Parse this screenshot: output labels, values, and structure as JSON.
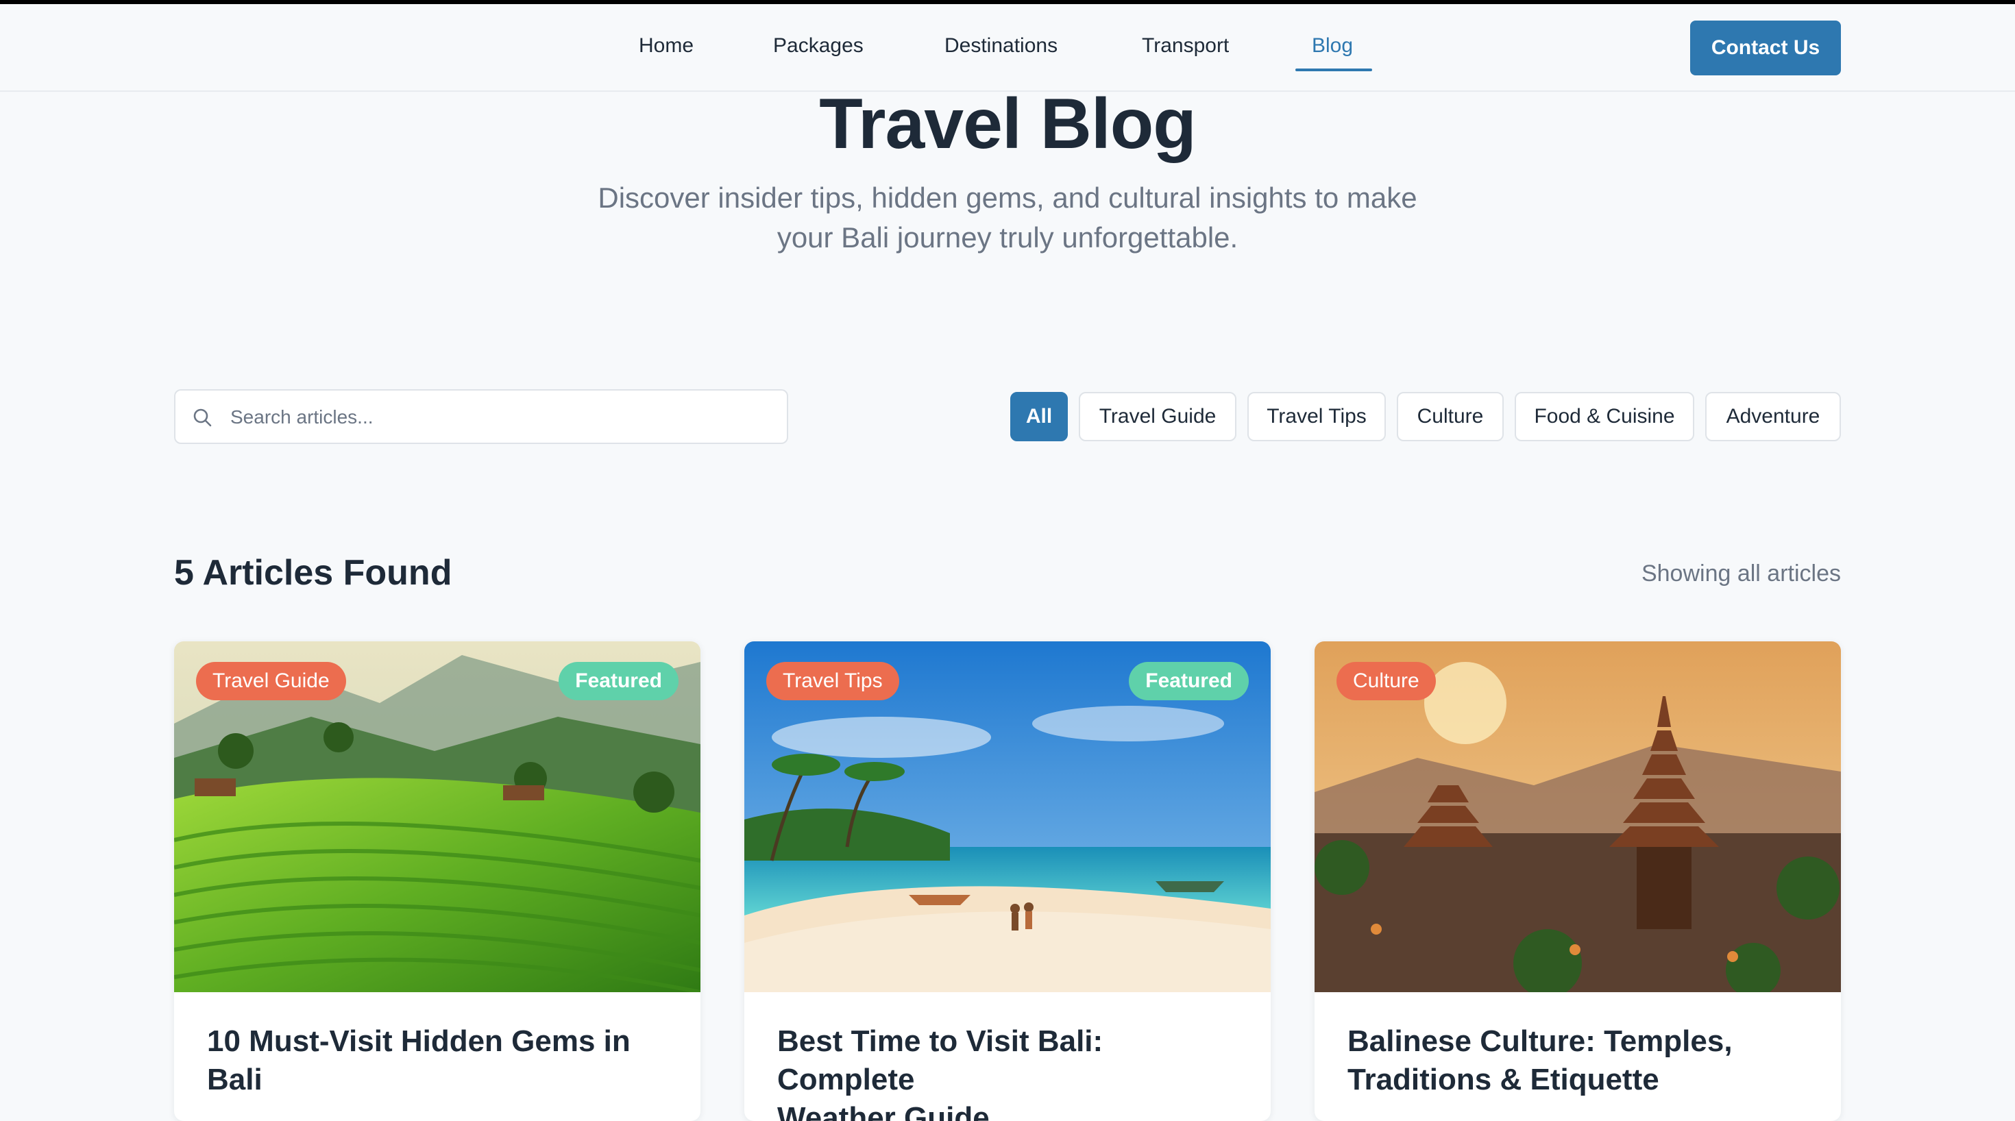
{
  "nav": {
    "items": [
      {
        "label": "Home"
      },
      {
        "label": "Packages"
      },
      {
        "label": "Destinations"
      },
      {
        "label": "Transport"
      },
      {
        "label": "Blog",
        "active": true
      }
    ],
    "contact_label": "Contact Us"
  },
  "hero": {
    "title": "Travel Blog",
    "subtitle_line1": "Discover insider tips, hidden gems, and cultural insights to make",
    "subtitle_line2": "your Bali journey truly unforgettable."
  },
  "search": {
    "placeholder": "Search articles...",
    "value": ""
  },
  "filters": [
    {
      "label": "All",
      "active": true
    },
    {
      "label": "Travel Guide"
    },
    {
      "label": "Travel Tips"
    },
    {
      "label": "Culture"
    },
    {
      "label": "Food & Cuisine"
    },
    {
      "label": "Adventure"
    }
  ],
  "results": {
    "count_label": "5 Articles Found",
    "status_label": "Showing all articles"
  },
  "articles": [
    {
      "category": "Travel Guide",
      "featured_label": "Featured",
      "title_line1": "10 Must-Visit Hidden Gems in",
      "title_line2": "Bali",
      "image": "rice-terraces"
    },
    {
      "category": "Travel Tips",
      "featured_label": "Featured",
      "title_line1": "Best Time to Visit Bali: Complete",
      "title_line2": "Weather Guide",
      "image": "beach"
    },
    {
      "category": "Culture",
      "featured_label": "",
      "title_line1": "Balinese Culture: Temples,",
      "title_line2": "Traditions & Etiquette",
      "image": "temple"
    }
  ],
  "colors": {
    "accent": "#2e78b0",
    "category_badge": "#ec6d4f",
    "featured_badge": "#5fd1aa",
    "text_dark": "#1e2a38",
    "text_muted": "#6b7584"
  }
}
